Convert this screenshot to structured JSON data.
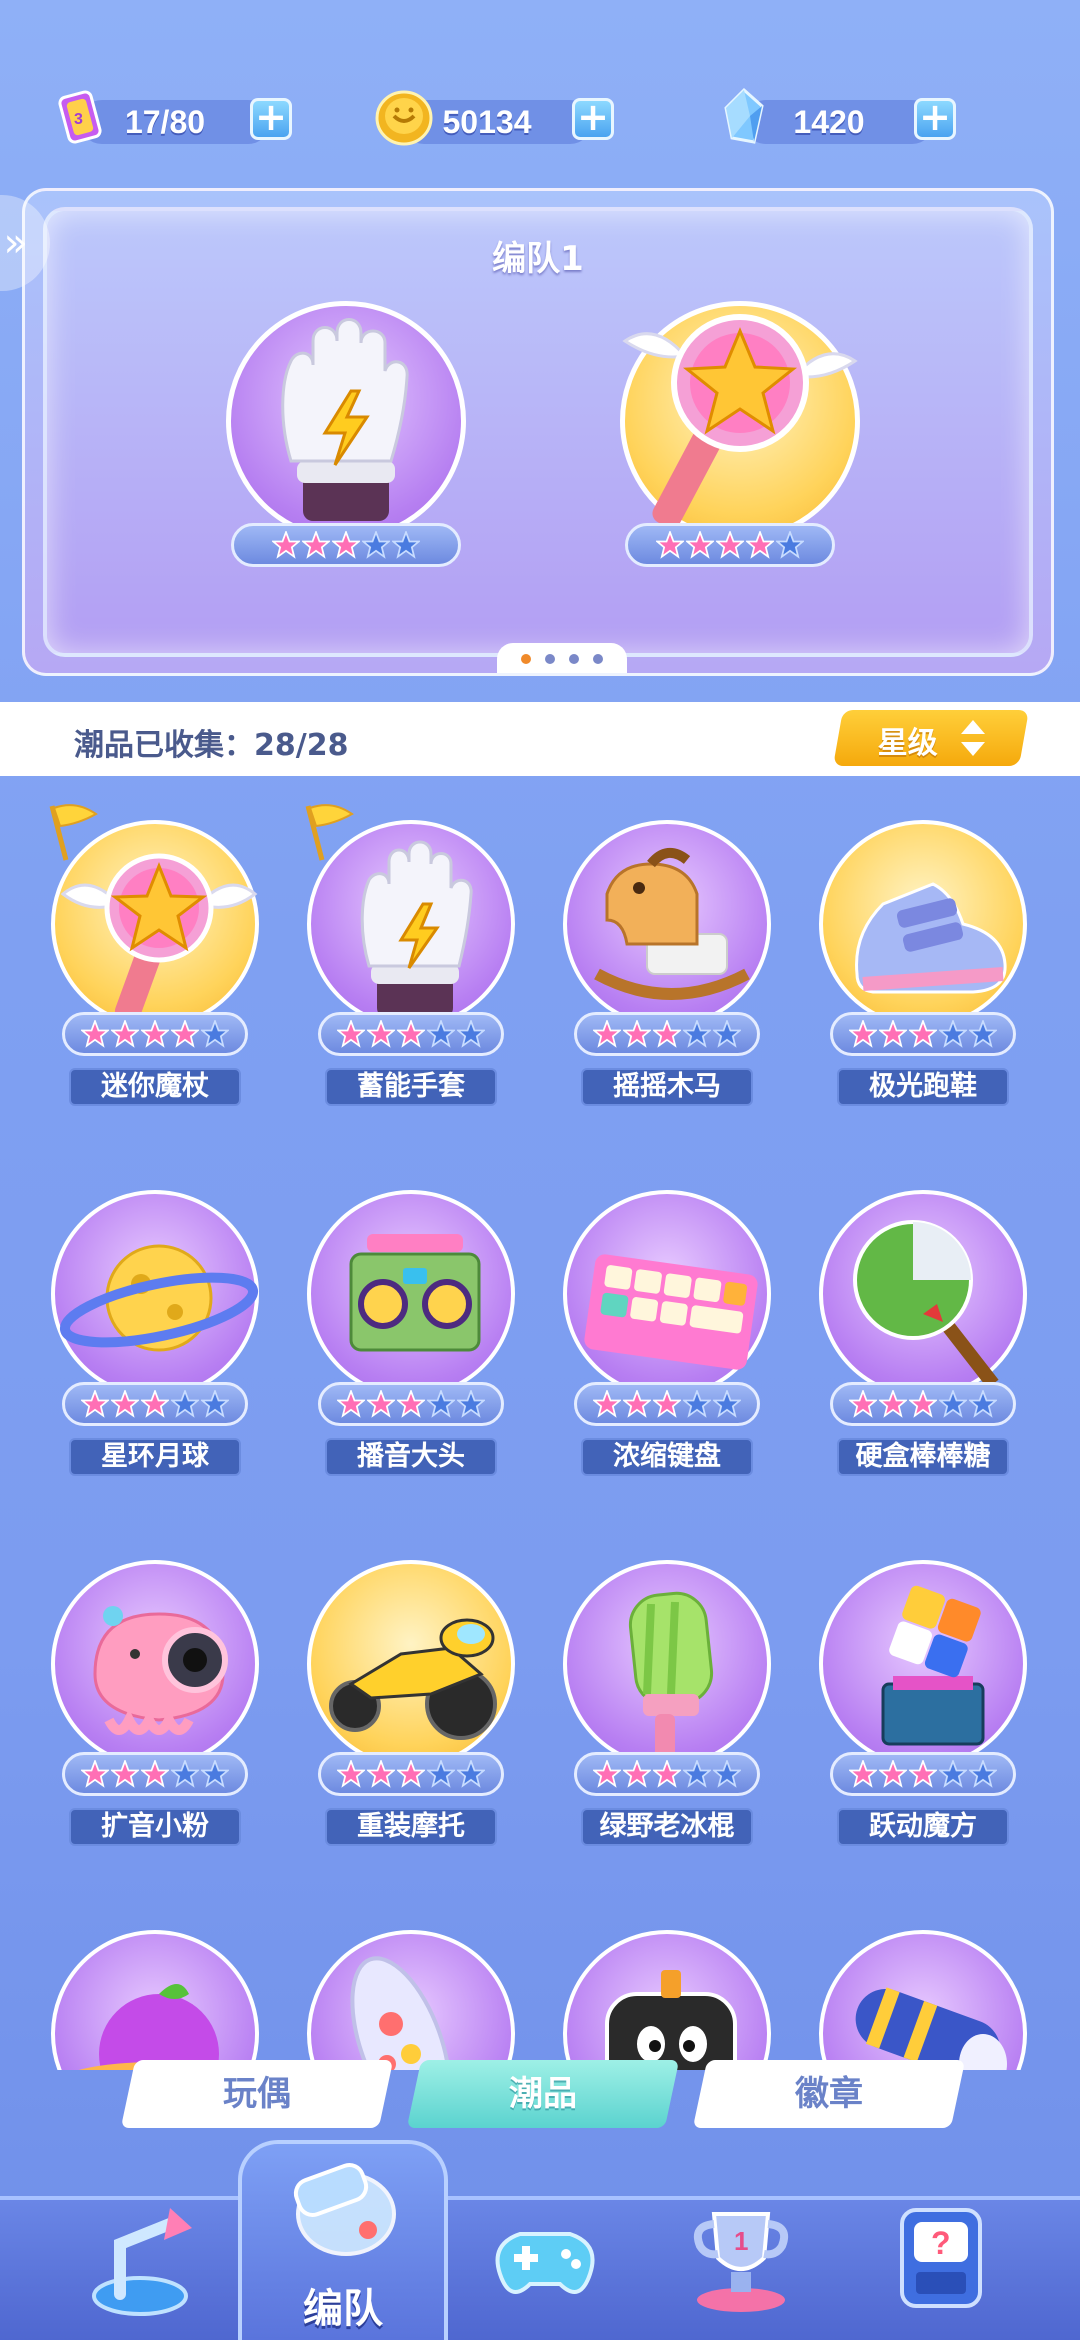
{
  "resources": [
    {
      "icon": "energy-ticket-icon",
      "value": "17/80"
    },
    {
      "icon": "gold-coin-icon",
      "value": "50134"
    },
    {
      "icon": "crystal-icon",
      "value": "1420"
    }
  ],
  "team": {
    "title": "编队1",
    "slots": [
      {
        "icon": "lightning-glove-icon",
        "stars_filled": 3,
        "stars_total": 5
      },
      {
        "icon": "star-wand-icon",
        "stars_filled": 4,
        "stars_total": 5
      }
    ],
    "page_count": 4,
    "current_page": 1
  },
  "collection": {
    "label": "潮品已收集：28/28",
    "sort_label": "星级"
  },
  "items": [
    {
      "name": "迷你魔杖",
      "icon": "star-wand-icon",
      "stars": 4,
      "flag": true,
      "bg": "gold"
    },
    {
      "name": "蓄能手套",
      "icon": "lightning-glove-icon",
      "stars": 3,
      "flag": true,
      "bg": "purple"
    },
    {
      "name": "摇摇木马",
      "icon": "rocking-horse-icon",
      "stars": 3,
      "flag": false,
      "bg": "purple"
    },
    {
      "name": "极光跑鞋",
      "icon": "sneaker-icon",
      "stars": 3,
      "flag": false,
      "bg": "gold"
    },
    {
      "name": "星环月球",
      "icon": "ringed-moon-icon",
      "stars": 3,
      "flag": false,
      "bg": "purple"
    },
    {
      "name": "播音大头",
      "icon": "boombox-icon",
      "stars": 3,
      "flag": false,
      "bg": "purple"
    },
    {
      "name": "浓缩键盘",
      "icon": "keyboard-icon",
      "stars": 3,
      "flag": false,
      "bg": "purple"
    },
    {
      "name": "硬盒棒棒糖",
      "icon": "lollipop-icon",
      "stars": 3,
      "flag": false,
      "bg": "purple"
    },
    {
      "name": "扩音小粉",
      "icon": "pink-speaker-icon",
      "stars": 3,
      "flag": false,
      "bg": "purple"
    },
    {
      "name": "重装摩托",
      "icon": "motorcycle-icon",
      "stars": 3,
      "flag": false,
      "bg": "gold"
    },
    {
      "name": "绿野老冰棍",
      "icon": "popsicle-icon",
      "stars": 3,
      "flag": false,
      "bg": "purple"
    },
    {
      "name": "跃动魔方",
      "icon": "rubik-cube-icon",
      "stars": 3,
      "flag": false,
      "bg": "purple"
    },
    {
      "name": "",
      "icon": "purple-planet-icon",
      "stars": 0,
      "flag": false,
      "bg": "purple"
    },
    {
      "name": "",
      "icon": "capsule-toy-icon",
      "stars": 0,
      "flag": false,
      "bg": "purple"
    },
    {
      "name": "",
      "icon": "robot-face-icon",
      "stars": 0,
      "flag": false,
      "bg": "purple"
    },
    {
      "name": "",
      "icon": "telescope-icon",
      "stars": 0,
      "flag": false,
      "bg": "purple"
    }
  ],
  "category_tabs": [
    {
      "label": "玩偶",
      "active": false
    },
    {
      "label": "潮品",
      "active": true
    },
    {
      "label": "徽章",
      "active": false
    }
  ],
  "bottom_nav": [
    {
      "icon": "back-arrow-icon",
      "label": ""
    },
    {
      "icon": "whistle-icon",
      "label": "编队",
      "active": true
    },
    {
      "icon": "gamepad-icon",
      "label": ""
    },
    {
      "icon": "trophy-icon",
      "label": ""
    },
    {
      "icon": "mystery-machine-icon",
      "label": ""
    }
  ],
  "colors": {
    "accent_gold": "#f5a90c",
    "star_pink": "#ff6fb5",
    "star_empty": "#4a7be0",
    "tab_active": "#5bd3cf"
  }
}
